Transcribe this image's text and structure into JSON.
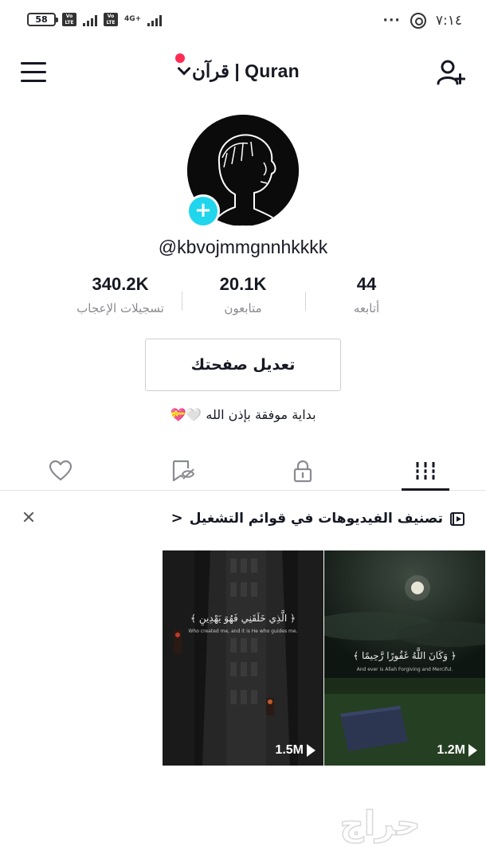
{
  "status_bar": {
    "battery": "58",
    "volte_label": "Vo LTE",
    "network": "4G+",
    "time": "٧:١٤",
    "more": "···"
  },
  "nav": {
    "account_title": "قرآن | Quran"
  },
  "profile": {
    "username": "@kbvojmmgnnhkkkk",
    "stats": [
      {
        "value": "340.2K",
        "label": "تسجيلات الإعجاب"
      },
      {
        "value": "20.1K",
        "label": "متابعون"
      },
      {
        "value": "44",
        "label": "أتابعه"
      }
    ],
    "edit_button": "تعديل صفحتك",
    "bio": "بداية موفقة بإذن الله 🤍💝"
  },
  "tabs": [
    "liked",
    "favorites",
    "private",
    "videos"
  ],
  "playlist_banner": {
    "text": "تصنيف الفيديوهات في قوائم التشغيل",
    "chevron": "<"
  },
  "videos": [
    {
      "views": "1.2M",
      "caption": "﴿ وَكَانَ اللَّهُ غَفُورًا رَّحِيمًا ﴾",
      "subcaption": "And ever is Allah Forgiving and Merciful."
    },
    {
      "views": "1.5M",
      "caption": "﴿ الَّذِي خَلَقَنِي فَهُوَ يَهْدِينِ ﴾",
      "subcaption": "Who created me, and it is He who guides me."
    }
  ],
  "watermark": "حراج",
  "colors": {
    "accent_red": "#fe2c55",
    "accent_cyan": "#20d5ec",
    "text_primary": "#161823",
    "text_secondary": "#8a8b91"
  }
}
